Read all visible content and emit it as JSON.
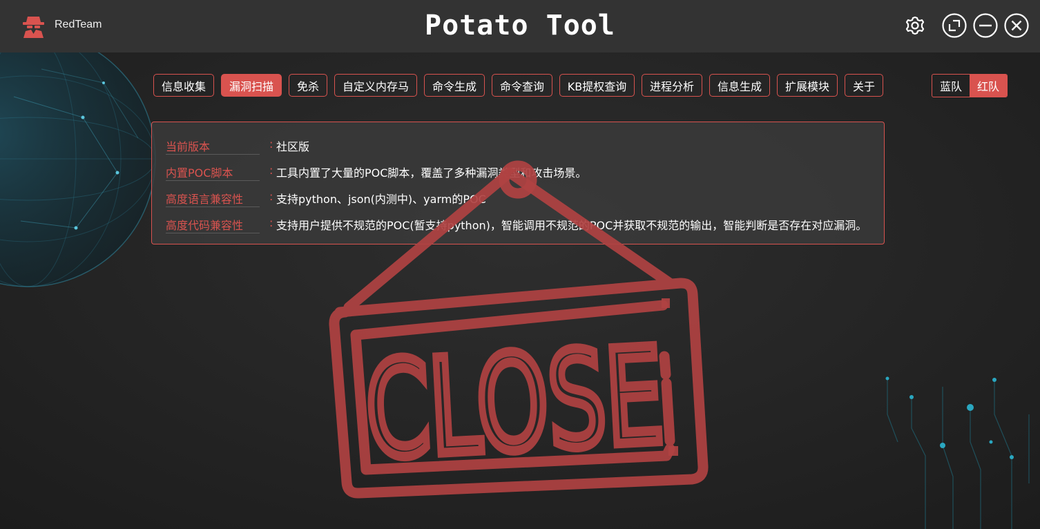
{
  "app": {
    "brand_name": "RedTeam",
    "title": "Potato Tool",
    "accent_color": "#d9534f"
  },
  "window_controls": [
    {
      "name": "settings-button",
      "icon": "gear-icon"
    },
    {
      "name": "restore-button",
      "icon": "restore-icon"
    },
    {
      "name": "minimize-button",
      "icon": "minus-icon"
    },
    {
      "name": "close-button",
      "icon": "close-icon"
    }
  ],
  "nav": {
    "items": [
      {
        "label": "信息收集",
        "active": false
      },
      {
        "label": "漏洞扫描",
        "active": true
      },
      {
        "label": "免杀",
        "active": false
      },
      {
        "label": "自定义内存马",
        "active": false
      },
      {
        "label": "命令生成",
        "active": false
      },
      {
        "label": "命令查询",
        "active": false
      },
      {
        "label": "KB提权查询",
        "active": false
      },
      {
        "label": "进程分析",
        "active": false
      },
      {
        "label": "信息生成",
        "active": false
      },
      {
        "label": "扩展模块",
        "active": false
      },
      {
        "label": "关于",
        "active": false
      }
    ]
  },
  "team_toggle": {
    "blue_label": "蓝队",
    "red_label": "红队",
    "selected": "红队"
  },
  "info": {
    "rows": [
      {
        "key": "当前版本",
        "sep": ":",
        "value": "社区版"
      },
      {
        "key": "内置POC脚本",
        "sep": ":",
        "value": "工具内置了大量的POC脚本，覆盖了多种漏洞类型和攻击场景。"
      },
      {
        "key": "高度语言兼容性",
        "sep": ":",
        "value": "支持python、json(内测中)、yarm的POC"
      },
      {
        "key": "高度代码兼容性",
        "sep": ":",
        "value": "支持用户提供不规范的POC(暂支持python)，智能调用不规范的POC并获取不规范的输出，智能判断是否存在对应漏洞。"
      }
    ]
  },
  "overlay": {
    "sign_text": "CLOSE",
    "sign_icon": "closed-sign-icon",
    "sign_color": "#b04242"
  }
}
